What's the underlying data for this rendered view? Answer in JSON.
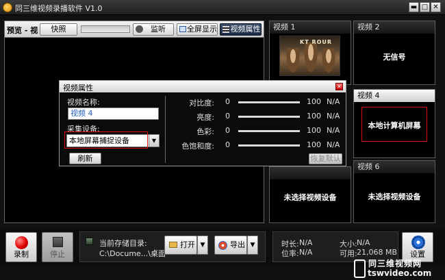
{
  "window": {
    "title": "同三维视频录播软件 V1.0",
    "min": "▬",
    "max": "□",
    "close": "✕"
  },
  "preview": {
    "label": "预览 - 视",
    "snapshot": "快照",
    "monitor": "监听",
    "fullscreen": "全屏显示",
    "video_props": "视频属性",
    "volume_level": 0
  },
  "channels": [
    {
      "title": "视频 1",
      "message": "",
      "thumb_title": "KT ROUR"
    },
    {
      "title": "视频 2",
      "message": "无信号"
    },
    {
      "title": "视频 4",
      "message": "本地计算机屏幕"
    },
    {
      "title": "",
      "message": "未选择视频设备"
    },
    {
      "title": "视频 6",
      "message": "未选择视频设备"
    }
  ],
  "dialog": {
    "title": "视频属性",
    "close": "✕",
    "name_label": "视频名称:",
    "name_value": "视频 4",
    "device_label": "采集设备:",
    "device_value": "本地屏幕捕捉设备",
    "refresh": "刷新",
    "restore": "恢复默认",
    "sliders": [
      {
        "label": "对比度:",
        "min": "0",
        "max": "100",
        "value": "N/A"
      },
      {
        "label": "亮度:",
        "min": "0",
        "max": "100",
        "value": "N/A"
      },
      {
        "label": "色彩:",
        "min": "0",
        "max": "100",
        "value": "N/A"
      },
      {
        "label": "色饱和度:",
        "min": "0",
        "max": "100",
        "value": "N/A"
      }
    ]
  },
  "bottom": {
    "record": "录制",
    "stop": "停止",
    "storage_label": "当前存储目录:",
    "storage_path": "C:\\Docume...\\桌面",
    "open": "打开",
    "export": "导出",
    "duration_label": "时长:",
    "duration_value": "N/A",
    "bitrate_label": "位率:",
    "bitrate_value": "N/A",
    "size_label": "大小:",
    "size_value": "N/A",
    "avail_label": "可用:",
    "avail_value": "21,068 MB",
    "settings": "设置"
  },
  "watermark": {
    "line1": "同三维视频网",
    "line2": "tswvideo.com"
  }
}
